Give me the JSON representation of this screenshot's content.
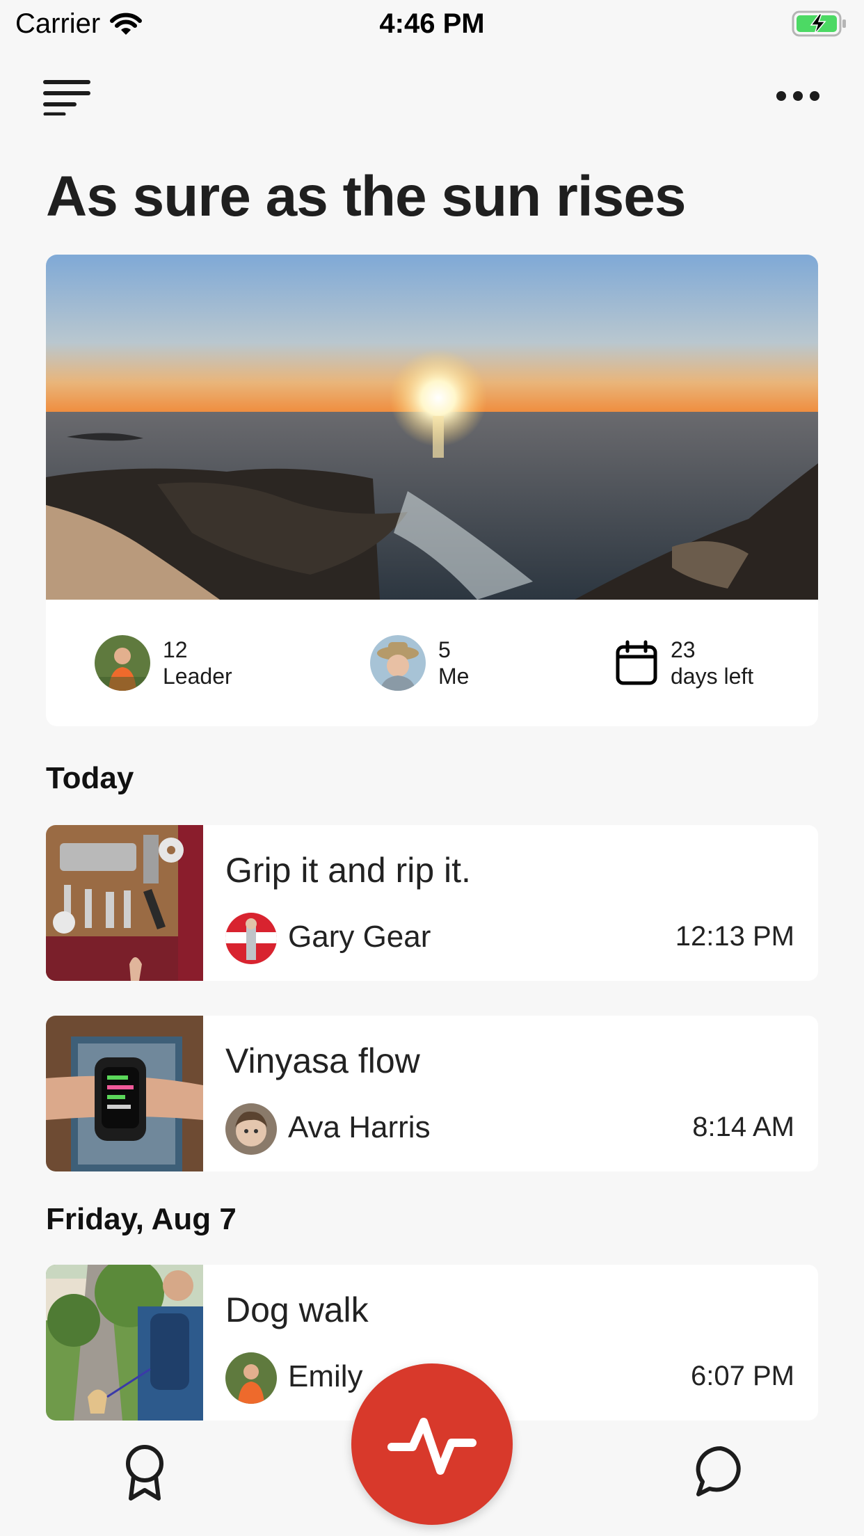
{
  "status_bar": {
    "carrier": "Carrier",
    "time": "4:46 PM"
  },
  "icons": {
    "menu": "menu-icon",
    "more": "ellipsis-icon",
    "wifi": "wifi-icon",
    "battery": "battery-charging-icon",
    "calendar": "calendar-icon",
    "badge": "award-icon",
    "activity": "activity-pulse-icon",
    "chat": "chat-bubble-icon"
  },
  "challenge": {
    "title": "As sure as the sun rises",
    "stats": [
      {
        "value": "12",
        "label": "Leader"
      },
      {
        "value": "5",
        "label": "Me"
      },
      {
        "value": "23",
        "label": "days left"
      }
    ]
  },
  "sections": [
    {
      "title": "Today",
      "activities": [
        {
          "title": "Grip it and rip it.",
          "user": "Gary Gear",
          "time": "12:13 PM"
        },
        {
          "title": "Vinyasa flow",
          "user": "Ava Harris",
          "time": "8:14 AM"
        }
      ]
    },
    {
      "title": "Friday, Aug 7",
      "activities": [
        {
          "title": "Dog walk",
          "user": "Emily",
          "time": "6:07 PM"
        }
      ]
    }
  ],
  "colors": {
    "accent": "#d8392b",
    "background": "#f7f7f7",
    "card": "#ffffff",
    "battery_charge": "#4cd964"
  }
}
